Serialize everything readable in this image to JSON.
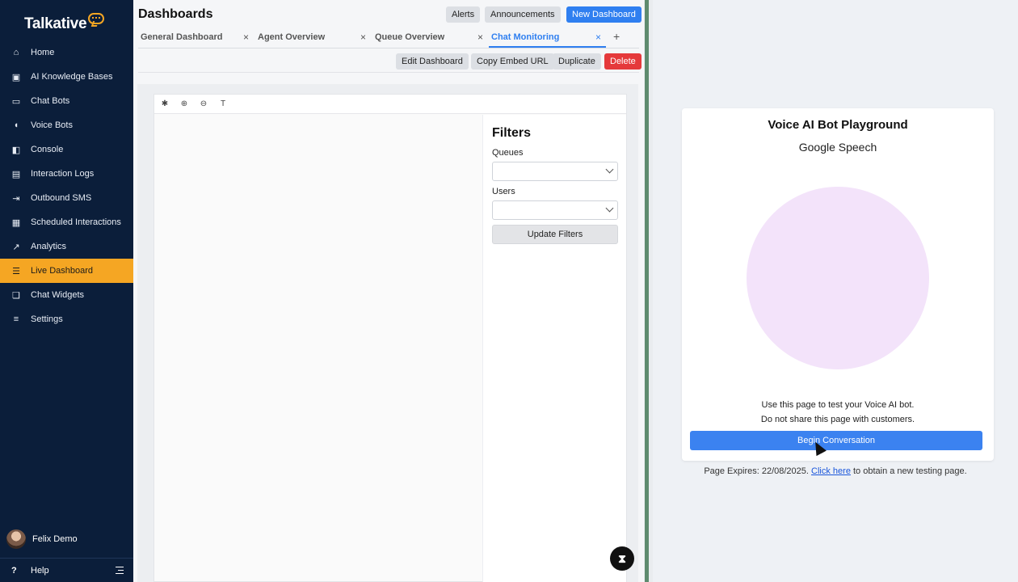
{
  "brand": {
    "name": "Talkative",
    "accent": "#f5a623"
  },
  "sidebar": {
    "items": [
      {
        "label": "Home",
        "icon": "home-icon"
      },
      {
        "label": "AI Knowledge Bases",
        "icon": "book-icon"
      },
      {
        "label": "Chat Bots",
        "icon": "chat-bot-icon"
      },
      {
        "label": "Voice Bots",
        "icon": "voice-wave-icon"
      },
      {
        "label": "Console",
        "icon": "console-icon"
      },
      {
        "label": "Interaction Logs",
        "icon": "log-icon"
      },
      {
        "label": "Outbound SMS",
        "icon": "outbound-icon"
      },
      {
        "label": "Scheduled Interactions",
        "icon": "calendar-icon"
      },
      {
        "label": "Analytics",
        "icon": "analytics-icon"
      },
      {
        "label": "Live Dashboard",
        "icon": "dashboard-list-icon",
        "active": true
      },
      {
        "label": "Chat Widgets",
        "icon": "chat-widgets-icon"
      },
      {
        "label": "Settings",
        "icon": "sliders-icon"
      }
    ],
    "user": "Felix Demo",
    "help": "Help"
  },
  "main": {
    "title": "Dashboards",
    "header_buttons": {
      "alerts": "Alerts",
      "announcements": "Announcements",
      "new_dashboard": "New Dashboard"
    },
    "tabs": [
      {
        "label": "General Dashboard"
      },
      {
        "label": "Agent Overview"
      },
      {
        "label": "Queue Overview"
      },
      {
        "label": "Chat Monitoring",
        "active": true
      }
    ],
    "tab_close": "×",
    "tab_add": "+",
    "actions": {
      "edit": "Edit Dashboard",
      "copy_embed": "Copy Embed URL",
      "duplicate": "Duplicate",
      "delete": "Delete"
    },
    "filters": {
      "title": "Filters",
      "queues_label": "Queues",
      "users_label": "Users",
      "update": "Update Filters"
    },
    "hourglass": "⧗"
  },
  "playground": {
    "title": "Voice AI Bot Playground",
    "subtitle": "Google Speech",
    "note1": "Use this page to test your Voice AI bot.",
    "note2": "Do not share this page with customers.",
    "begin": "Begin Conversation",
    "expires_prefix": "Page Expires: 22/08/2025.",
    "expires_link": "Click here",
    "expires_suffix": "to obtain a new testing page."
  },
  "colors": {
    "sidebar_bg": "#0b1e3a",
    "primary": "#2f7ff0",
    "danger": "#e5393b",
    "orb": "#f3e3fa"
  }
}
